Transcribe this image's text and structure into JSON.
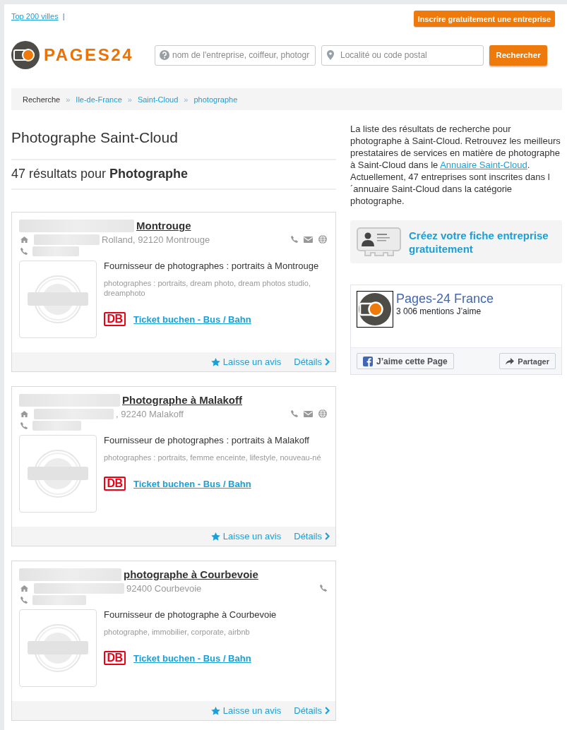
{
  "header": {
    "top_link": "Top 200 villes",
    "separator": "|",
    "register_button": "Inscrire gratuitement une entreprise",
    "logo_text": "PAGES24"
  },
  "search": {
    "query": {
      "placeholder": "nom de l'entreprise, coiffeur, photogr"
    },
    "location": {
      "placeholder": "Localité ou code postal"
    },
    "button": "Rechercher"
  },
  "breadcrumb": {
    "separator": "»",
    "items": [
      {
        "label": "Recherche",
        "kind": "text"
      },
      {
        "label": "Ile-de-France",
        "kind": "link"
      },
      {
        "label": "Saint-Cloud",
        "kind": "link"
      },
      {
        "label": "photographe",
        "kind": "link"
      }
    ]
  },
  "results": {
    "title": "Photographe Saint-Cloud",
    "summary": "47 résultats pour **Photographe**"
  },
  "listings": [
    {
      "name": "Montrouge",
      "address": "Rolland, 92120 Montrouge",
      "contacts": {
        "phone": true,
        "email": true,
        "website": true
      },
      "description": "Fournisseur de photographes : portraits à Montrouge",
      "tags": "photographes : portraits, dream photo, dream photos studio, dreamphoto",
      "transit_badge": "DB",
      "transit_link": "Ticket buchen - Bus / Bahn",
      "review_link": "Laisse un avis",
      "details_link": "Détails"
    },
    {
      "name": "Photographe à Malakoff",
      "address": ", 92240 Malakoff",
      "contacts": {
        "phone": true,
        "email": true,
        "website": true
      },
      "description": "Fournisseur de photographes : portraits à Malakoff",
      "tags": "photographes : portraits, femme enceinte, lifestyle, nouveau-né",
      "transit_badge": "DB",
      "transit_link": "Ticket buchen - Bus / Bahn",
      "review_link": "Laisse un avis",
      "details_link": "Détails"
    },
    {
      "name": "photographe à Courbevoie",
      "address": "92400 Courbevoie",
      "contacts": {
        "phone": true,
        "email": false,
        "website": false
      },
      "description": "Fournisseur de photographe à Courbevoie",
      "tags": "photographe, immobilier, corporate, airbnb",
      "transit_badge": "DB",
      "transit_link": "Ticket buchen - Bus / Bahn",
      "review_link": "Laisse un avis",
      "details_link": "Détails"
    }
  ],
  "sidebar": {
    "intro": {
      "before": "La liste des résultats de recherche pour photographe à Saint-Cloud. Retrouvez les meilleurs prestataires de services en matière de photographe à Saint-Cloud dans le ",
      "link": "Annuaire Saint-Cloud",
      "after": ". Actuellement, 47 entreprises sont inscrites dans l´annuaire Saint-Cloud dans la catégorie photographe."
    },
    "cta": "Créez votre fiche entreprise gratuitement",
    "facebook": {
      "page_name": "Pages-24 France",
      "likes": "3 006 mentions J’aime",
      "like_button": "J’aime cette Page",
      "share_button": "Partager"
    }
  }
}
